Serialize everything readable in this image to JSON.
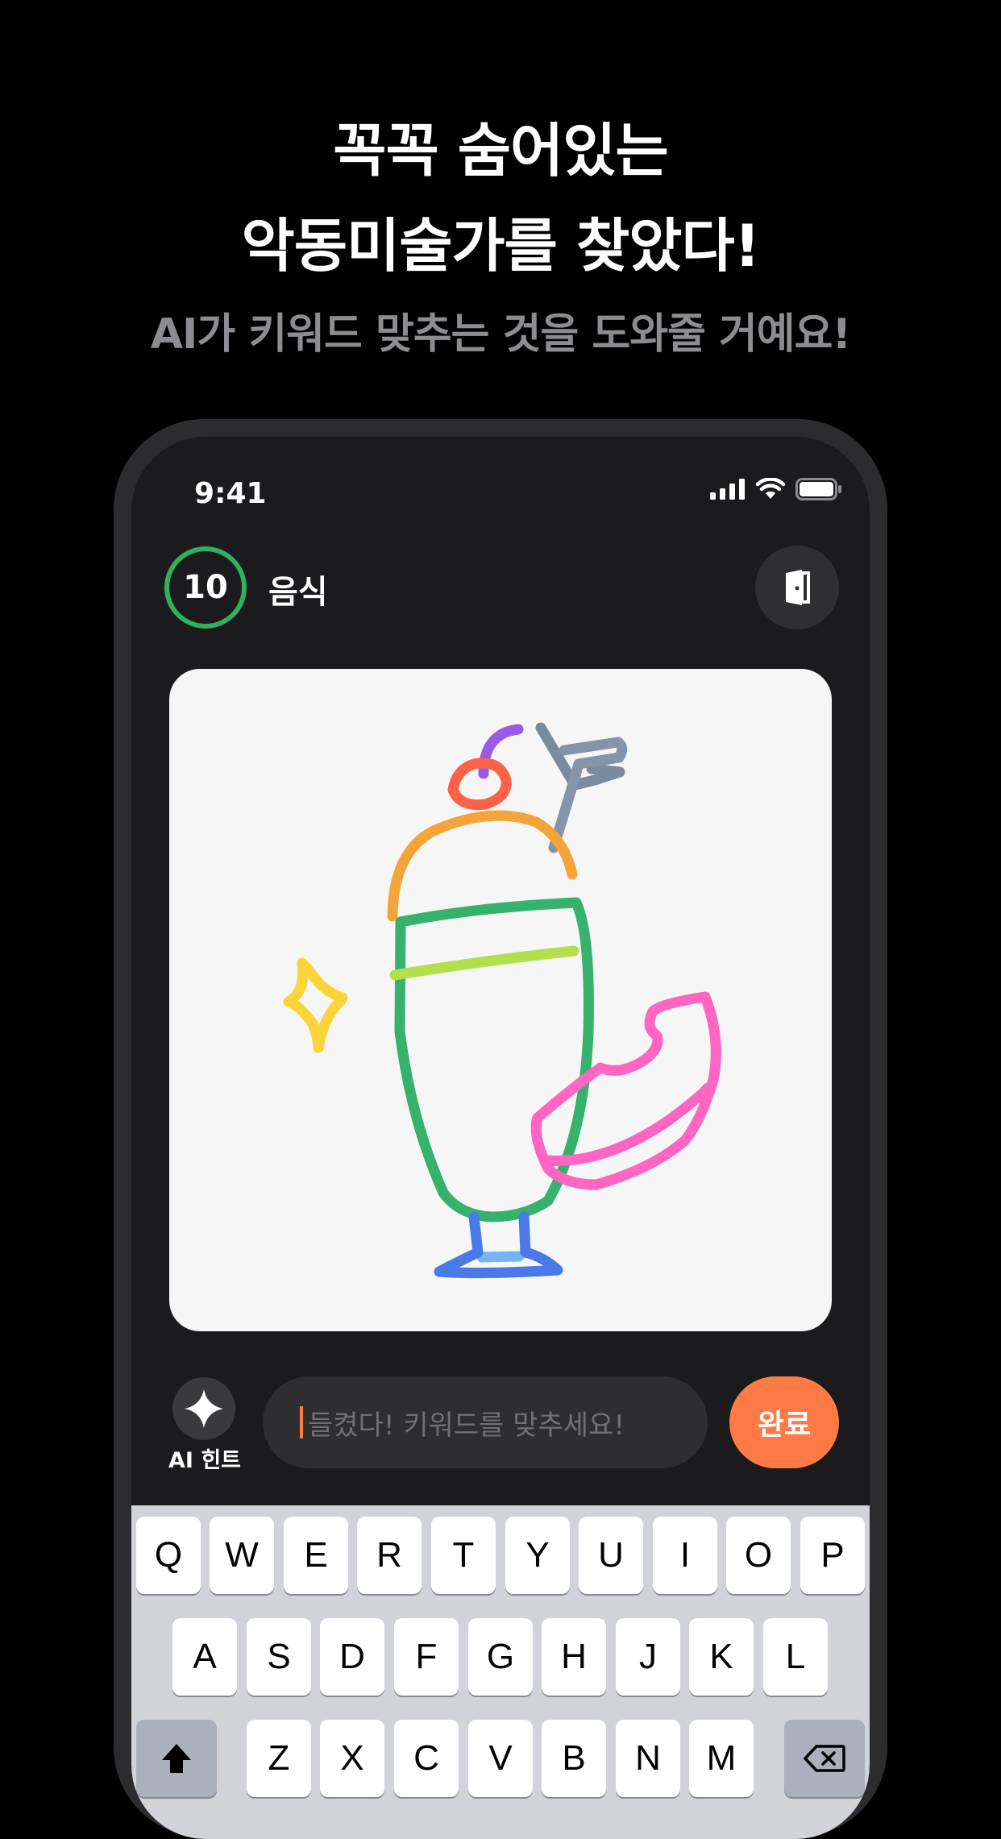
{
  "promo": {
    "headline_line1": "꼭꼭 숨어있는",
    "headline_line2": "악동미술가를 찾았다!",
    "subline": "AI가 키워드 맞추는 것을 도와줄 거예요!"
  },
  "status_bar": {
    "time": "9:41"
  },
  "game": {
    "timer_value": "10",
    "category": "음식",
    "hint_label": "AI 힌트",
    "guess_placeholder": "들켰다! 키워드를 맞추세요!",
    "done_label": "완료"
  },
  "keyboard": {
    "row1": [
      "Q",
      "W",
      "E",
      "R",
      "T",
      "Y",
      "U",
      "I",
      "O",
      "P"
    ],
    "row2": [
      "A",
      "S",
      "D",
      "F",
      "G",
      "H",
      "J",
      "K",
      "L"
    ],
    "row3": [
      "Z",
      "X",
      "C",
      "V",
      "B",
      "N",
      "M"
    ]
  },
  "colors": {
    "accent": "#FF7A45",
    "timer_ring": "#2DB15F",
    "background": "#000000",
    "screen": "#1B1B1D",
    "canvas": "#F6F6F6"
  }
}
